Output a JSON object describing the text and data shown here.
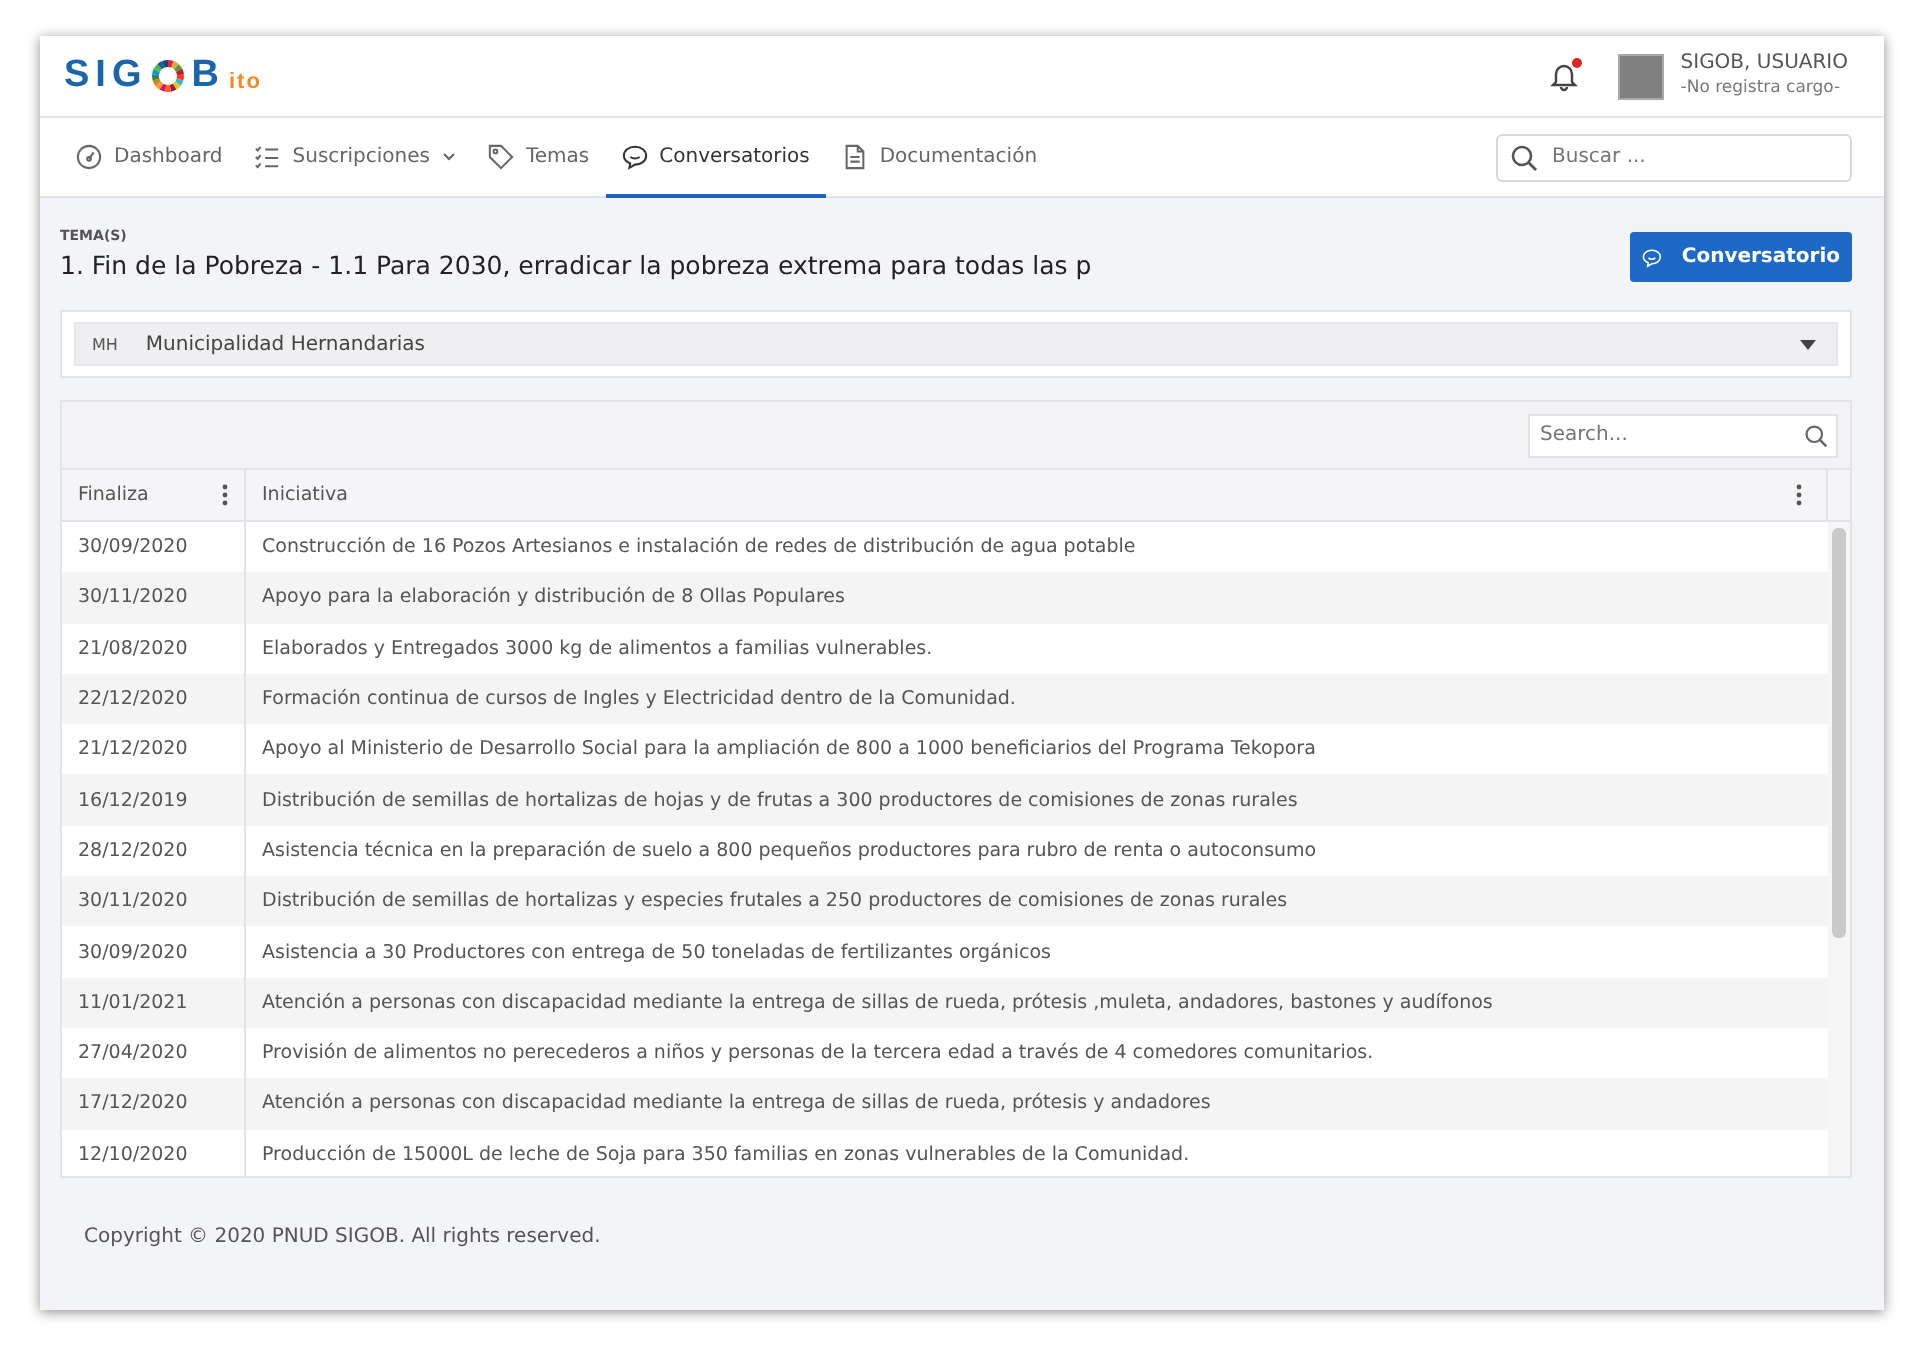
{
  "logo": {
    "before": "SIG",
    "after": "B",
    "suffix": "ito"
  },
  "header": {
    "notification_dot": true,
    "user_name": "SIGOB, USUARIO",
    "user_role": "-No registra cargo-"
  },
  "nav": [
    {
      "label": "Dashboard",
      "kind": "gauge",
      "selected": false,
      "dropdown": false
    },
    {
      "label": "Suscripciones",
      "kind": "list",
      "selected": false,
      "dropdown": true
    },
    {
      "label": "Temas",
      "kind": "tag",
      "selected": false,
      "dropdown": false
    },
    {
      "label": "Conversatorios",
      "kind": "chat",
      "selected": true,
      "dropdown": false
    },
    {
      "label": "Documentación",
      "kind": "file",
      "selected": false,
      "dropdown": false
    }
  ],
  "search": {
    "placeholder": "Buscar ..."
  },
  "topic": {
    "label": "TEMA(S)",
    "title": "1. Fin de la Pobreza - 1.1 Para 2030, erradicar la pobreza extrema para todas las p"
  },
  "action_button": "Conversatorio",
  "select": {
    "badge": "MH",
    "value": "Municipalidad Hernandarias"
  },
  "table": {
    "search_placeholder": "Search...",
    "columns": [
      "Finaliza",
      "Iniciativa"
    ],
    "rows": [
      [
        "30/09/2020",
        "Construcción de 16 Pozos Artesianos e instalación de redes de distribución de agua potable"
      ],
      [
        "30/11/2020",
        "Apoyo para la elaboración y distribución de 8 Ollas Populares"
      ],
      [
        "21/08/2020",
        "Elaborados y Entregados 3000 kg de alimentos a familias vulnerables."
      ],
      [
        "22/12/2020",
        "Formación continua de cursos de Ingles y Electricidad dentro de la Comunidad."
      ],
      [
        "21/12/2020",
        "Apoyo al Ministerio de Desarrollo Social para la ampliación de 800 a 1000 beneficiarios del Programa Tekopora"
      ],
      [
        "16/12/2019",
        "Distribución de semillas de hortalizas de hojas y de frutas a 300 productores de comisiones de zonas rurales"
      ],
      [
        "28/12/2020",
        "Asistencia técnica en la preparación de suelo a 800 pequeños productores para rubro de renta o autoconsumo"
      ],
      [
        "30/11/2020",
        "Distribución de semillas de hortalizas y especies frutales a 250 productores de comisiones de zonas rurales"
      ],
      [
        "30/09/2020",
        "Asistencia a 30 Productores con entrega de 50 toneladas de fertilizantes orgánicos"
      ],
      [
        "11/01/2021",
        "Atención a personas con discapacidad mediante la entrega de sillas de rueda, prótesis ,muleta, andadores, bastones y audífonos"
      ],
      [
        "27/04/2020",
        "Provisión de alimentos no perecederos a niños y personas de la tercera edad a través de 4 comedores comunitarios."
      ],
      [
        "17/12/2020",
        "Atención a personas con discapacidad mediante la entrega de sillas de rueda, prótesis y andadores"
      ],
      [
        "12/10/2020",
        "Producción de 15000L de leche de Soja para 350 familias en zonas vulnerables de la Comunidad."
      ]
    ]
  },
  "footer": "Copyright © 2020 PNUD SIGOB. All rights reserved."
}
